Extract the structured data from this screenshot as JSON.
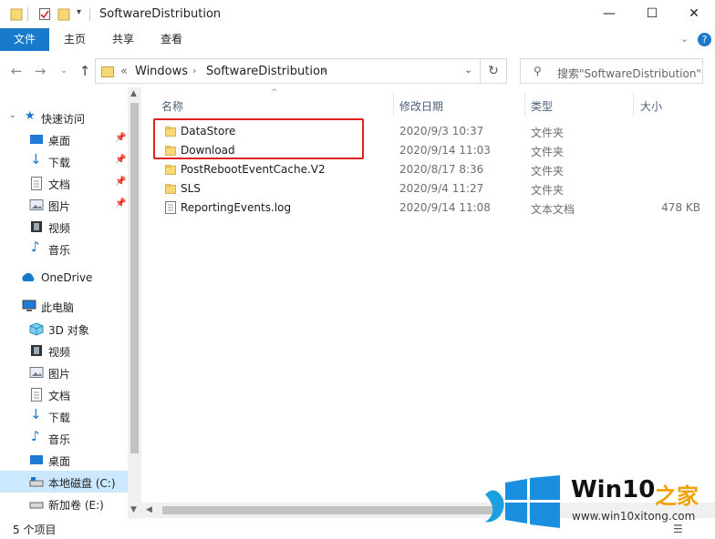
{
  "window": {
    "title": "SoftwareDistribution",
    "minimize_glyph": "—",
    "maximize_glyph": "☐",
    "close_glyph": "✕"
  },
  "ribbon": {
    "tabs": [
      "文件",
      "主页",
      "共享",
      "查看"
    ],
    "file_tab_color": "#1979ca"
  },
  "address": {
    "overflow": "«",
    "crumbs": [
      "Windows",
      "SoftwareDistribution"
    ],
    "search_placeholder": "搜索\"SoftwareDistribution\""
  },
  "nav": {
    "items": [
      {
        "label": "快速访问",
        "icon": "star-icon"
      },
      {
        "label": "桌面",
        "icon": "desktop-icon",
        "pinned": true
      },
      {
        "label": "下载",
        "icon": "download-icon",
        "pinned": true
      },
      {
        "label": "文档",
        "icon": "document-icon",
        "pinned": true
      },
      {
        "label": "图片",
        "icon": "picture-icon",
        "pinned": true
      },
      {
        "label": "视频",
        "icon": "video-icon"
      },
      {
        "label": "音乐",
        "icon": "music-icon"
      },
      {
        "label": "OneDrive",
        "icon": "cloud-icon"
      },
      {
        "label": "此电脑",
        "icon": "computer-icon"
      },
      {
        "label": "3D 对象",
        "icon": "cube-icon"
      },
      {
        "label": "视频",
        "icon": "video-icon"
      },
      {
        "label": "图片",
        "icon": "picture-icon"
      },
      {
        "label": "文档",
        "icon": "document-icon"
      },
      {
        "label": "下载",
        "icon": "download-icon"
      },
      {
        "label": "音乐",
        "icon": "music-icon"
      },
      {
        "label": "桌面",
        "icon": "desktop-icon"
      },
      {
        "label": "本地磁盘 (C:)",
        "icon": "drive-icon",
        "selected": true
      },
      {
        "label": "新加卷 (E:)",
        "icon": "drive-icon"
      }
    ]
  },
  "columns": {
    "name": "名称",
    "date": "修改日期",
    "type": "类型",
    "size": "大小"
  },
  "files": [
    {
      "name": "DataStore",
      "date": "2020/9/3 10:37",
      "type": "文件夹",
      "size": "",
      "kind": "folder"
    },
    {
      "name": "Download",
      "date": "2020/9/14 11:03",
      "type": "文件夹",
      "size": "",
      "kind": "folder"
    },
    {
      "name": "PostRebootEventCache.V2",
      "date": "2020/8/17 8:36",
      "type": "文件夹",
      "size": "",
      "kind": "folder"
    },
    {
      "name": "SLS",
      "date": "2020/9/4 11:27",
      "type": "文件夹",
      "size": "",
      "kind": "folder"
    },
    {
      "name": "ReportingEvents.log",
      "date": "2020/9/14 11:08",
      "type": "文本文档",
      "size": "478 KB",
      "kind": "file"
    }
  ],
  "status": {
    "item_count": "5 个项目"
  },
  "watermark": {
    "brand": "Win10",
    "brand_suffix": "之家",
    "url": "www.win10xitong.com"
  }
}
